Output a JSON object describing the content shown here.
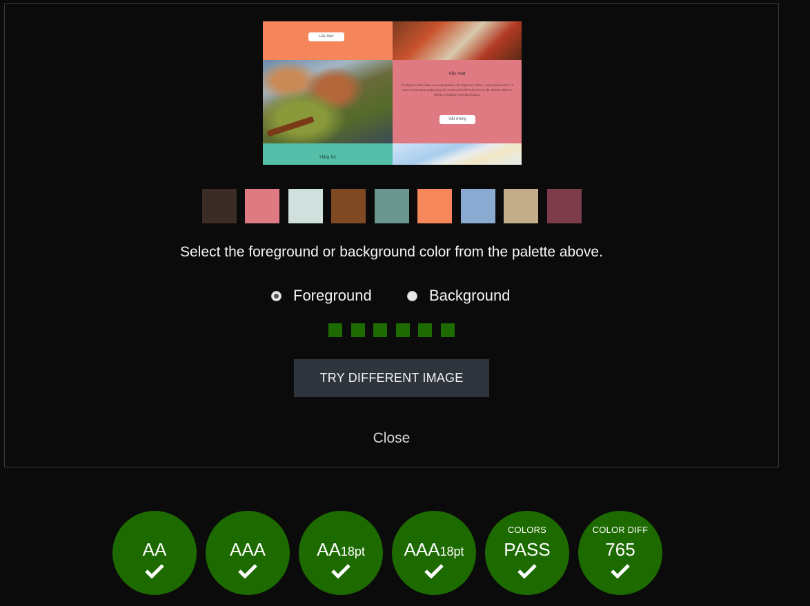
{
  "preview": {
    "btn_top": "Läs mer",
    "section_title": "Vår mat",
    "section_text": "Vi erbjuder både lakto-ovo-vegetariska och veganska rätter. Lorem ipsum dolor sit amet consectetur adipiscing elit. Amet velit eleifend lorem ut elit. Dictum dolor in efficitur tincidunt imperdiet finibus.",
    "btn_menu": "Vår meny",
    "teal_label": "Hitta hit"
  },
  "palette": [
    "#3b2c25",
    "#de7a82",
    "#d0e1dd",
    "#7f4a23",
    "#6b958f",
    "#f5875a",
    "#89abd2",
    "#c3ad88",
    "#7d3c4a"
  ],
  "instructions": "Select the foreground or background color from the palette above.",
  "radios": [
    {
      "label": "Foreground",
      "checked": true
    },
    {
      "label": "Background",
      "checked": false
    }
  ],
  "try_button": "TRY DIFFERENT IMAGE",
  "close_label": "Close",
  "badges": [
    {
      "main": "AA",
      "suffix": "",
      "top": ""
    },
    {
      "main": "AAA",
      "suffix": "",
      "top": ""
    },
    {
      "main": "AA",
      "suffix": "18pt",
      "top": ""
    },
    {
      "main": "AAA",
      "suffix": "18pt",
      "top": ""
    },
    {
      "main": "PASS",
      "suffix": "",
      "top": "COLORS"
    },
    {
      "main": "765",
      "suffix": "",
      "top": "COLOR DIFF"
    }
  ],
  "colors": {
    "pass_green": "#1d6b00",
    "button_bg": "#2f353c",
    "page_bg": "#0b0b0b"
  }
}
